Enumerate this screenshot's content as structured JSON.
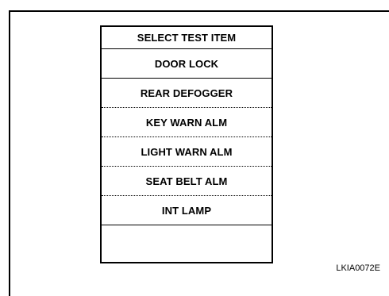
{
  "menu": {
    "title": "SELECT TEST ITEM",
    "items": [
      {
        "label": "DOOR LOCK"
      },
      {
        "label": "REAR DEFOGGER"
      },
      {
        "label": "KEY WARN ALM"
      },
      {
        "label": "LIGHT WARN ALM"
      },
      {
        "label": "SEAT BELT ALM"
      },
      {
        "label": "INT LAMP"
      },
      {
        "label": ""
      }
    ]
  },
  "figure_code": "LKIA0072E"
}
